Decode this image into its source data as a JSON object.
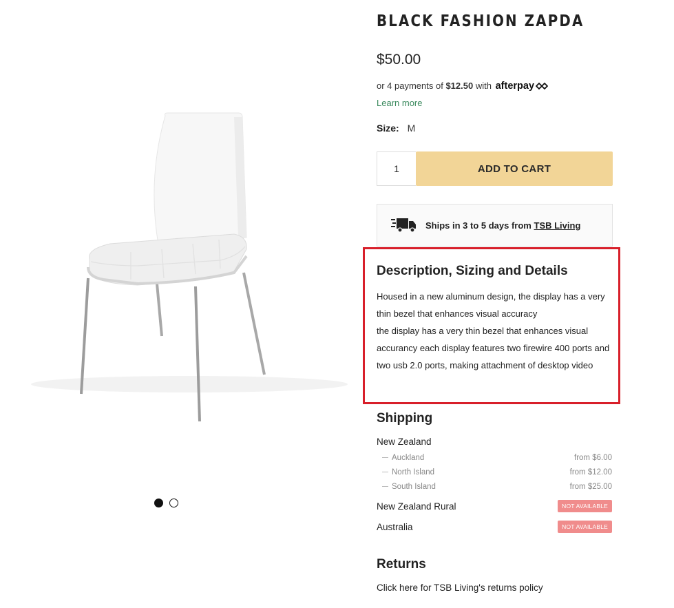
{
  "product": {
    "title": "BLACK FASHION ZAPDA",
    "price": "$50.00",
    "afterpay": {
      "prefix": "or 4 payments of",
      "amount": "$12.50",
      "connector": "with",
      "brand": "afterpay",
      "learn_more": "Learn more"
    },
    "size": {
      "label": "Size:",
      "value": "M"
    },
    "quantity": "1",
    "add_to_cart": "ADD TO CART",
    "shipping_notice": {
      "text": "Ships in 3 to 5 days from",
      "vendor": "TSB Living"
    }
  },
  "gallery": {
    "dots": 2,
    "active": 0
  },
  "description": {
    "title": "Description, Sizing and Details",
    "body": "Housed in a new aluminum design, the display has a very thin bezel that enhances visual accuracy\nthe display has a very thin bezel that enhances visual accurancy each display features two firewire 400 ports and two usb 2.0 ports, making attachment of desktop video"
  },
  "shipping": {
    "title": "Shipping",
    "regions": [
      {
        "name": "New Zealand",
        "subregions": [
          {
            "name": "Auckland",
            "price": "from $6.00"
          },
          {
            "name": "North Island",
            "price": "from $12.00"
          },
          {
            "name": "South Island",
            "price": "from $25.00"
          }
        ]
      },
      {
        "name": "New Zealand Rural",
        "status": "NOT AVAILABLE"
      },
      {
        "name": "Australia",
        "status": "NOT AVAILABLE"
      }
    ]
  },
  "returns": {
    "title": "Returns",
    "link": "Click here for TSB Living's returns policy"
  },
  "colors": {
    "add_to_cart_bg": "#f2d597",
    "learn_more": "#3b8a5e",
    "highlight_border": "#d81f2a",
    "not_available_badge": "#f08c8c"
  }
}
